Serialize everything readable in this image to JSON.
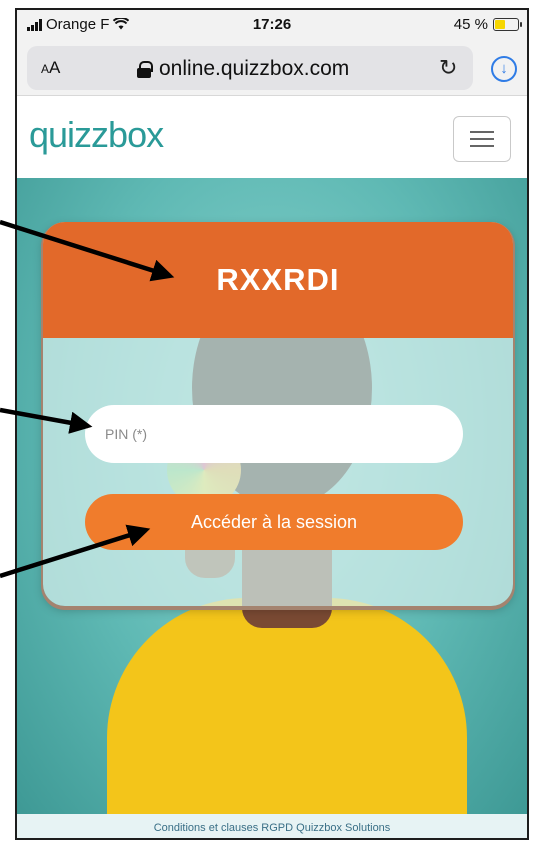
{
  "status_bar": {
    "carrier": "Orange F",
    "time": "17:26",
    "battery_percent": "45 %",
    "battery_level": 0.45,
    "wifi_icon": "wifi-icon",
    "signal_icon": "signal-icon"
  },
  "browser": {
    "text_size_label_small": "A",
    "text_size_label_large": "A",
    "url": "online.quizzbox.com",
    "lock_icon": "lock-icon",
    "reload_icon": "reload-icon",
    "download_icon": "download-icon"
  },
  "site": {
    "logo": "quizzbox",
    "menu_icon": "hamburger-menu-icon",
    "brand_color": "#2a9a98"
  },
  "card": {
    "session_code": "RXXRDI",
    "header_color": "#e2692a",
    "pin_placeholder": "PIN (*)",
    "pin_value": "",
    "access_button_label": "Accéder à la session",
    "button_color": "#f07c2c"
  },
  "footer": {
    "text": "Conditions et clauses RGPD Quizzbox Solutions"
  },
  "annotations": {
    "arrow_color": "#000000",
    "count": 3
  }
}
